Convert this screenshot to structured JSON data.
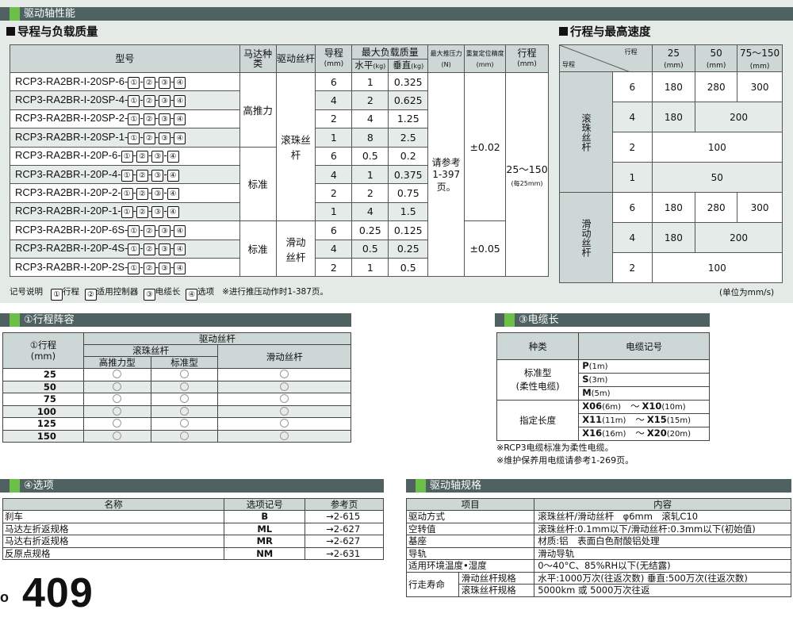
{
  "header": {
    "title": "驱动轴性能"
  },
  "load": {
    "title": "导程与负载质量",
    "headers": {
      "model": "型号",
      "motor": "马达种类",
      "screw": "驱动丝杆",
      "lead": "导程",
      "lead_unit": "(mm)",
      "maxload": "最大负载质量",
      "horiz": "水平",
      "vert": "垂直",
      "kg": "(kg)",
      "push": "最大推压力",
      "push_unit": "(N)",
      "repeat": "重复定位精度",
      "repeat_unit": "(mm)",
      "stroke": "行程",
      "stroke_unit": "(mm)"
    },
    "rows": [
      {
        "model": "RCP3-RA2BR-I-20SP-6-",
        "lead": "6",
        "h": "1",
        "v": "0.325"
      },
      {
        "model": "RCP3-RA2BR-I-20SP-4-",
        "lead": "4",
        "h": "2",
        "v": "0.625"
      },
      {
        "model": "RCP3-RA2BR-I-20SP-2-",
        "lead": "2",
        "h": "4",
        "v": "1.25"
      },
      {
        "model": "RCP3-RA2BR-I-20SP-1-",
        "lead": "1",
        "h": "8",
        "v": "2.5"
      },
      {
        "model": "RCP3-RA2BR-I-20P-6-",
        "lead": "6",
        "h": "0.5",
        "v": "0.2"
      },
      {
        "model": "RCP3-RA2BR-I-20P-4-",
        "lead": "4",
        "h": "1",
        "v": "0.375"
      },
      {
        "model": "RCP3-RA2BR-I-20P-2-",
        "lead": "2",
        "h": "2",
        "v": "0.75"
      },
      {
        "model": "RCP3-RA2BR-I-20P-1-",
        "lead": "1",
        "h": "4",
        "v": "1.5"
      },
      {
        "model": "RCP3-RA2BR-I-20P-6S-",
        "lead": "6",
        "h": "0.25",
        "v": "0.125"
      },
      {
        "model": "RCP3-RA2BR-I-20P-4S-",
        "lead": "4",
        "h": "0.5",
        "v": "0.25"
      },
      {
        "model": "RCP3-RA2BR-I-20P-2S-",
        "lead": "2",
        "h": "1",
        "v": "0.5"
      }
    ],
    "suffix": [
      "①",
      "②",
      "③",
      "④"
    ],
    "motor_high": "高推力",
    "motor_std1": "标准",
    "motor_std2": "标准",
    "screw_ball": "滚珠丝杆",
    "screw_slide": "滑动丝杆",
    "push_note": "请参考1-397页。",
    "repeat_ball": "±0.02",
    "repeat_slide": "±0.05",
    "stroke_val": "25～150",
    "stroke_note": "(每25mm)"
  },
  "legend": {
    "label": "记号说明",
    "items": [
      {
        "n": "①",
        "t": "行程"
      },
      {
        "n": "②",
        "t": "适用控制器"
      },
      {
        "n": "③",
        "t": "电缆长"
      },
      {
        "n": "④",
        "t": "选项"
      }
    ],
    "note": "※进行推压动作时1-387页。"
  },
  "speed": {
    "title": "行程与最高速度",
    "corner_top": "行程",
    "corner_bottom": "导程",
    "cols": [
      {
        "v": "25",
        "u": "(mm)"
      },
      {
        "v": "50",
        "u": "(mm)"
      },
      {
        "v": "75～150",
        "u": "(mm)"
      }
    ],
    "ball_label": "滚珠丝杆",
    "slide_label": "滑动丝杆",
    "ball": [
      {
        "lead": "6",
        "a": "180",
        "b": "280",
        "c": "300"
      },
      {
        "lead": "4",
        "a": "180",
        "bc": "200"
      },
      {
        "lead": "2",
        "all": "100"
      },
      {
        "lead": "1",
        "all": "50"
      }
    ],
    "slide": [
      {
        "lead": "6",
        "a": "180",
        "b": "280",
        "c": "300"
      },
      {
        "lead": "4",
        "a": "180",
        "bc": "200"
      },
      {
        "lead": "2",
        "all": "100"
      }
    ],
    "unit": "(单位为mm/s)"
  },
  "strokes": {
    "title": "①行程阵容",
    "h_stroke": "①行程",
    "h_mm": "(mm)",
    "h_drive": "驱动丝杆",
    "h_ball": "滚珠丝杆",
    "h_slide": "滑动丝杆",
    "h_high": "高推力型",
    "h_std": "标准型",
    "rows": [
      "25",
      "50",
      "75",
      "100",
      "125",
      "150"
    ]
  },
  "cable": {
    "title": "③电缆长",
    "h_kind": "种类",
    "h_code": "电缆记号",
    "std_label": "标准型",
    "std_sub": "(柔性电缆)",
    "std": [
      {
        "c": "P",
        "l": "(1m)"
      },
      {
        "c": "S",
        "l": "(3m)"
      },
      {
        "c": "M",
        "l": "(5m)"
      }
    ],
    "spec_label": "指定长度",
    "spec": [
      {
        "a": "X06",
        "al": "(6m)",
        "b": "X10",
        "bl": "(10m)"
      },
      {
        "a": "X11",
        "al": "(11m)",
        "b": "X15",
        "bl": "(15m)"
      },
      {
        "a": "X16",
        "al": "(16m)",
        "b": "X20",
        "bl": "(20m)"
      }
    ],
    "tilde": "～",
    "notes": [
      "※RCP3电缆标准为柔性电缆。",
      "※维护保养用电缆请参考1-269页。"
    ]
  },
  "options": {
    "title": "④选项",
    "headers": [
      "名称",
      "选项记号",
      "参考页"
    ],
    "rows": [
      [
        "刹车",
        "B",
        "→2-615"
      ],
      [
        "马达左折返规格",
        "ML",
        "→2-627"
      ],
      [
        "马达右折返规格",
        "MR",
        "→2-627"
      ],
      [
        "反原点规格",
        "NM",
        "→2-631"
      ]
    ]
  },
  "spec": {
    "title": "驱动轴规格",
    "headers": [
      "项目",
      "内容"
    ],
    "rows": [
      [
        "驱动方式",
        "滚珠丝杆/滑动丝杆　φ6mm　滚轧C10"
      ],
      [
        "空转值",
        "滚珠丝杆:0.1mm以下/滑动丝杆:0.3mm以下(初始值)"
      ],
      [
        "基座",
        "材质:铝　表面白色耐酸铝处理"
      ],
      [
        "导轨",
        "滑动导轨"
      ],
      [
        "适用环境温度•湿度",
        "0～40°C、85%RH以下(无结露)"
      ]
    ],
    "life_label": "行走寿命",
    "life": [
      [
        "滑动丝杆规格",
        "水平:1000万次(往返次数) 垂直:500万次(往返次数)"
      ],
      [
        "滚珠丝杆规格",
        "5000km 或 5000万次往返"
      ]
    ]
  },
  "footer": {
    "page": "409"
  }
}
